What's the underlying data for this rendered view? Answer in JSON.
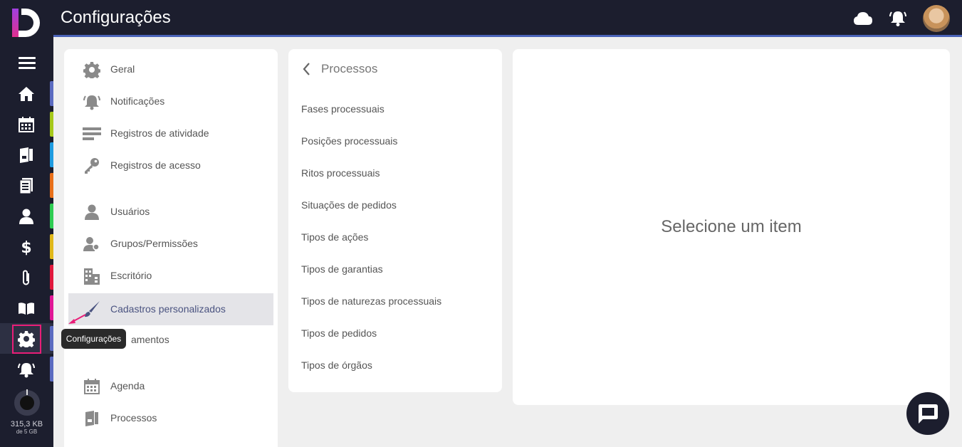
{
  "topbar": {
    "title": "Configurações"
  },
  "rail": {
    "items": [
      {
        "name": "home",
        "stripe": "#5b6bc0"
      },
      {
        "name": "calendar",
        "stripe": "#a6c81a"
      },
      {
        "name": "processes",
        "stripe": "#1e9be0"
      },
      {
        "name": "documents",
        "stripe": "#e8701a"
      },
      {
        "name": "contacts",
        "stripe": "#2ecc52"
      },
      {
        "name": "finance",
        "stripe": "#e0b81a"
      },
      {
        "name": "attachments",
        "stripe": "#e0183c"
      },
      {
        "name": "library",
        "stripe": "#e01896"
      },
      {
        "name": "settings",
        "stripe": "#5b6bc0"
      },
      {
        "name": "notifications",
        "stripe": "#5b6bc0"
      }
    ],
    "storage": {
      "used": "315,3 KB",
      "total": "de 5 GB"
    }
  },
  "settings_menu": {
    "items": [
      {
        "label": "Geral",
        "icon": "gear-icon"
      },
      {
        "label": "Notificações",
        "icon": "bell-icon"
      },
      {
        "label": "Registros de atividade",
        "icon": "list-icon"
      },
      {
        "label": "Registros de acesso",
        "icon": "key-icon"
      },
      {
        "label": "Usuários",
        "icon": "user-icon"
      },
      {
        "label": "Grupos/Permissões",
        "icon": "users-icon"
      },
      {
        "label": "Escritório",
        "icon": "building-icon"
      },
      {
        "label": "Cadastros personalizados",
        "icon": "brush-icon"
      },
      {
        "label": "amentos",
        "icon": ""
      },
      {
        "label": "Agenda",
        "icon": "calendar-icon"
      },
      {
        "label": "Processos",
        "icon": "folder-icon"
      }
    ]
  },
  "submenu": {
    "back_label": "Processos",
    "items": [
      "Fases processuais",
      "Posições processuais",
      "Ritos processuais",
      "Situações de pedidos",
      "Tipos de ações",
      "Tipos de garantias",
      "Tipos de naturezas processuais",
      "Tipos de pedidos",
      "Tipos de órgãos"
    ]
  },
  "detail": {
    "empty_text": "Selecione um item"
  },
  "tooltip": {
    "text": "Configurações"
  }
}
